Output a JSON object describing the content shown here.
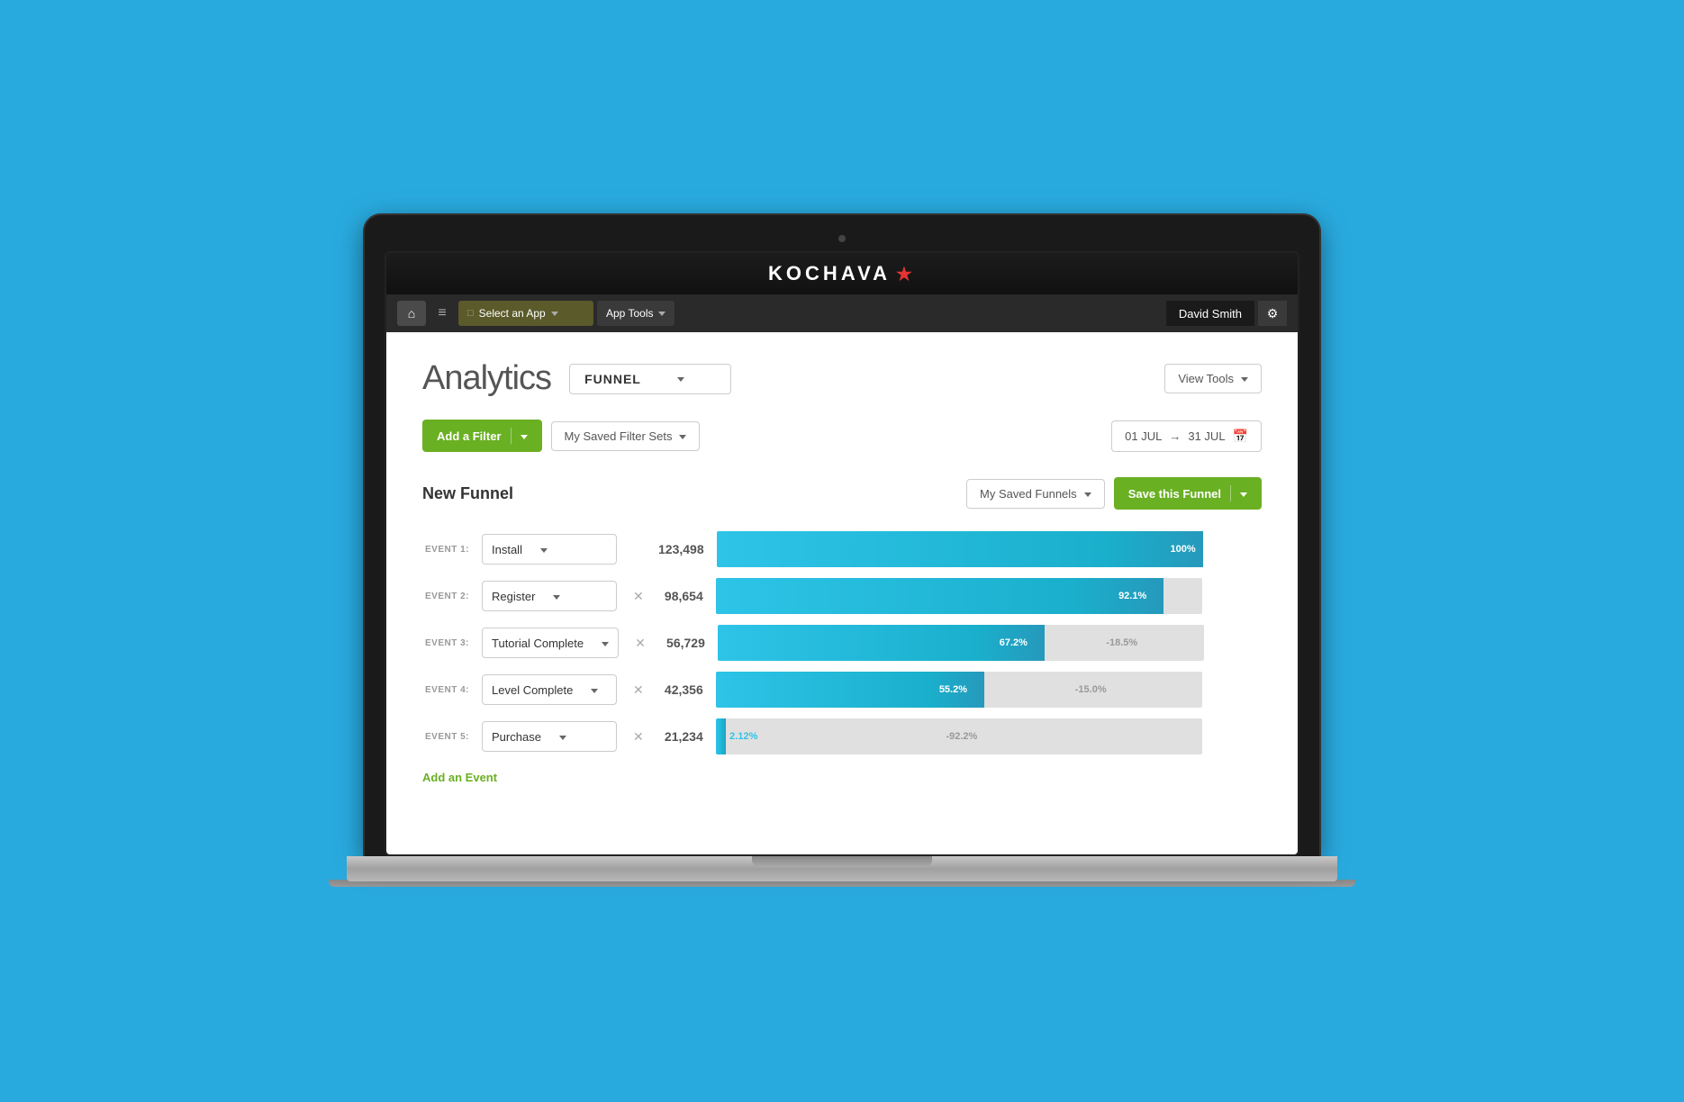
{
  "brand": {
    "name": "KOCHAVA",
    "star": "★"
  },
  "navbar": {
    "select_app_label": "Select an App",
    "app_tools_label": "App Tools",
    "user_name": "David Smith",
    "home_icon": "⌂",
    "menu_icon": "≡",
    "settings_icon": "⚙",
    "select_icon": "□"
  },
  "page": {
    "title": "Analytics",
    "view_type": "FUNNEL",
    "view_tools_label": "View Tools"
  },
  "filters": {
    "add_filter_label": "Add a Filter",
    "saved_filters_label": "My Saved Filter Sets",
    "date_start": "01 JUL",
    "date_arrow": "→",
    "date_end": "31 JUL",
    "calendar_icon": "📅"
  },
  "funnel": {
    "title": "New Funnel",
    "saved_funnels_label": "My Saved Funnels",
    "save_funnel_label": "Save this Funnel",
    "add_event_label": "Add an Event",
    "events": [
      {
        "label": "EVENT 1:",
        "name": "Install",
        "count": "123,498",
        "bar_width_pct": 100,
        "bg_width_pct": 0,
        "main_color": "#2ec4e8",
        "dark_color": "#1ab0d6",
        "label_inner": "100%",
        "label_inner_pos": "right",
        "label_extra": "",
        "show_close": false
      },
      {
        "label": "EVENT 2:",
        "name": "Register",
        "count": "98,654",
        "bar_width_pct": 92.1,
        "bg_width_pct": 7.9,
        "main_color": "#2ec4e8",
        "dark_color": "#1ab0d6",
        "label_inner": "92.1%",
        "label_inner_pos": "right",
        "label_extra": "",
        "show_close": true
      },
      {
        "label": "EVENT 3:",
        "name": "Tutorial Complete",
        "count": "56,729",
        "bar_width_pct": 67.2,
        "bg_width_pct": 32.8,
        "main_color": "#2ec4e8",
        "dark_color": "#1ab0d6",
        "label_inner": "67.2%",
        "label_inner_pos": "right",
        "label_extra": "-18.5%",
        "show_close": true
      },
      {
        "label": "EVENT 4:",
        "name": "Level Complete",
        "count": "42,356",
        "bar_width_pct": 55.2,
        "bg_width_pct": 44.8,
        "main_color": "#2ec4e8",
        "dark_color": "#1ab0d6",
        "label_inner": "55.2%",
        "label_inner_pos": "right",
        "label_extra": "-15.0%",
        "show_close": true
      },
      {
        "label": "EVENT 5:",
        "name": "Purchase",
        "count": "21,234",
        "bar_width_pct": 2.12,
        "bg_width_pct": 97.88,
        "main_color": "#2ec4e8",
        "dark_color": "#1ab0d6",
        "label_inner": "2.12%",
        "label_inner_pos": "right_of_bar",
        "label_extra": "-92.2%",
        "show_close": true
      }
    ]
  }
}
